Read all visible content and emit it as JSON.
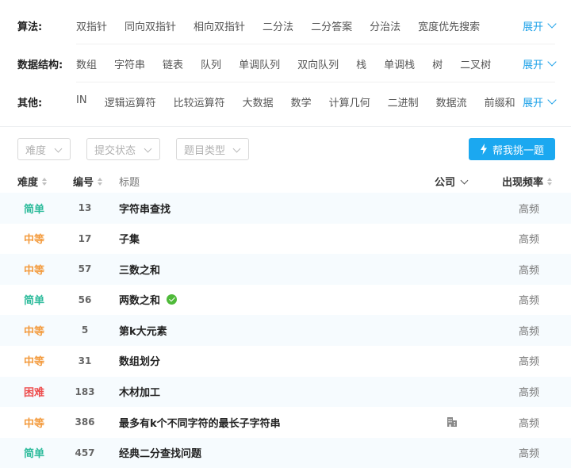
{
  "filters": {
    "expand_label": "展开",
    "rows": [
      {
        "label": "算法:",
        "tags": [
          "双指针",
          "同向双指针",
          "相向双指针",
          "二分法",
          "二分答案",
          "分治法",
          "宽度优先搜索"
        ]
      },
      {
        "label": "数据结构:",
        "tags": [
          "数组",
          "字符串",
          "链表",
          "队列",
          "单调队列",
          "双向队列",
          "栈",
          "单调栈",
          "树",
          "二叉树"
        ]
      },
      {
        "label": "其他:",
        "tags": [
          "IN",
          "逻辑运算符",
          "比较运算符",
          "大数据",
          "数学",
          "计算几何",
          "二进制",
          "数据流",
          "前缀和"
        ]
      }
    ]
  },
  "toolbar": {
    "difficulty_placeholder": "难度",
    "status_placeholder": "提交状态",
    "type_placeholder": "题目类型",
    "pick_button": "帮我挑一题"
  },
  "table": {
    "headers": {
      "difficulty": "难度",
      "number": "编号",
      "title": "标题",
      "company": "公司",
      "frequency": "出现频率"
    },
    "rows": [
      {
        "difficulty": "简单",
        "level": "easy",
        "number": "13",
        "title": "字符串查找",
        "solved": false,
        "has_company": false,
        "frequency": "高频"
      },
      {
        "difficulty": "中等",
        "level": "medium",
        "number": "17",
        "title": "子集",
        "solved": false,
        "has_company": false,
        "frequency": "高频"
      },
      {
        "difficulty": "中等",
        "level": "medium",
        "number": "57",
        "title": "三数之和",
        "solved": false,
        "has_company": false,
        "frequency": "高频"
      },
      {
        "difficulty": "简单",
        "level": "easy",
        "number": "56",
        "title": "两数之和",
        "solved": true,
        "has_company": false,
        "frequency": "高频"
      },
      {
        "difficulty": "中等",
        "level": "medium",
        "number": "5",
        "title": "第k大元素",
        "solved": false,
        "has_company": false,
        "frequency": "高频"
      },
      {
        "difficulty": "中等",
        "level": "medium",
        "number": "31",
        "title": "数组划分",
        "solved": false,
        "has_company": false,
        "frequency": "高频"
      },
      {
        "difficulty": "困难",
        "level": "hard",
        "number": "183",
        "title": "木材加工",
        "solved": false,
        "has_company": false,
        "frequency": "高频"
      },
      {
        "difficulty": "中等",
        "level": "medium",
        "number": "386",
        "title": "最多有k个不同字符的最长子字符串",
        "solved": false,
        "has_company": true,
        "frequency": "高频"
      },
      {
        "difficulty": "简单",
        "level": "easy",
        "number": "457",
        "title": "经典二分查找问题",
        "solved": false,
        "has_company": false,
        "frequency": "高频"
      }
    ]
  },
  "colors": {
    "accent": "#1ba8f0",
    "easy": "#2cbb9b",
    "medium": "#f39a3c",
    "hard": "#ee4d4d",
    "solved": "#4fba3a"
  }
}
